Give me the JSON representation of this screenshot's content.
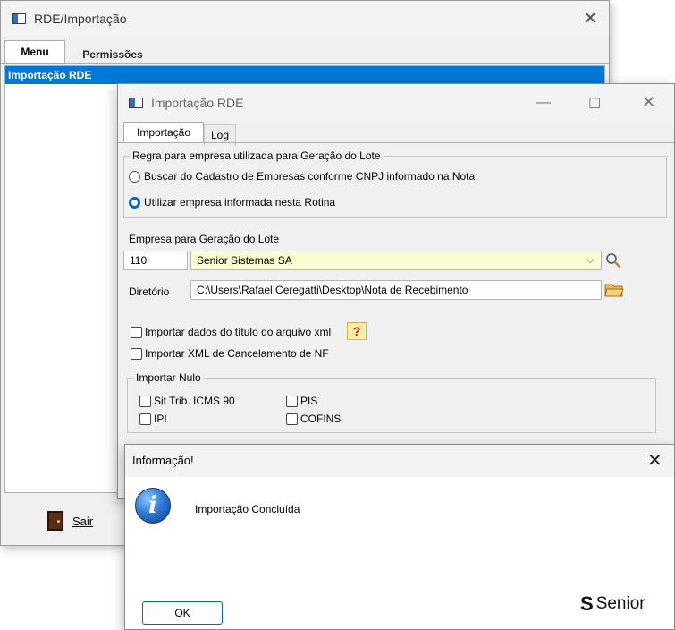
{
  "main_window": {
    "title": "RDE/Importação",
    "tabs": [
      {
        "label": "Menu"
      },
      {
        "label": "Permissões"
      }
    ],
    "list_items": [
      "Importação RDE"
    ],
    "exit_button": "Sair"
  },
  "import_window": {
    "title": "Importação RDE",
    "tabs": [
      {
        "label": "Importação"
      },
      {
        "label": "Log"
      }
    ],
    "rule_group": {
      "title": "Regra para empresa utilizada para Geração do Lote",
      "options": [
        {
          "label": "Buscar do Cadastro de Empresas conforme CNPJ informado na Nota",
          "selected": false
        },
        {
          "label": "Utilizar empresa informada nesta Rotina",
          "selected": true
        }
      ]
    },
    "empresa_label": "Empresa para Geração do Lote",
    "empresa_code": "110",
    "empresa_name": "Senior Sistemas SA",
    "diretorio_label": "Diretório",
    "diretorio_value": "C:\\Users\\Rafael.Ceregatti\\Desktop\\Nota de Recebimento",
    "checks": [
      {
        "label": "Importar dados do título do arquivo xml",
        "checked": false
      },
      {
        "label": "Importar XML de Cancelamento de NF",
        "checked": false
      }
    ],
    "help_glyph": "?",
    "nulo_group": {
      "title": "Importar Nulo",
      "items": [
        {
          "label": "Sit Trib. ICMS 90",
          "checked": false
        },
        {
          "label": "PIS",
          "checked": false
        },
        {
          "label": "IPI",
          "checked": false
        },
        {
          "label": "COFINS",
          "checked": false
        }
      ]
    }
  },
  "info_dialog": {
    "title": "Informação!",
    "message": "Importação Concluída",
    "ok_label": "OK",
    "brand": "Senior",
    "brand_mark": "S"
  },
  "colors": {
    "selection_blue": "#0078d7",
    "accent": "#0067c0",
    "input_yellow": "#fcfcd2"
  }
}
